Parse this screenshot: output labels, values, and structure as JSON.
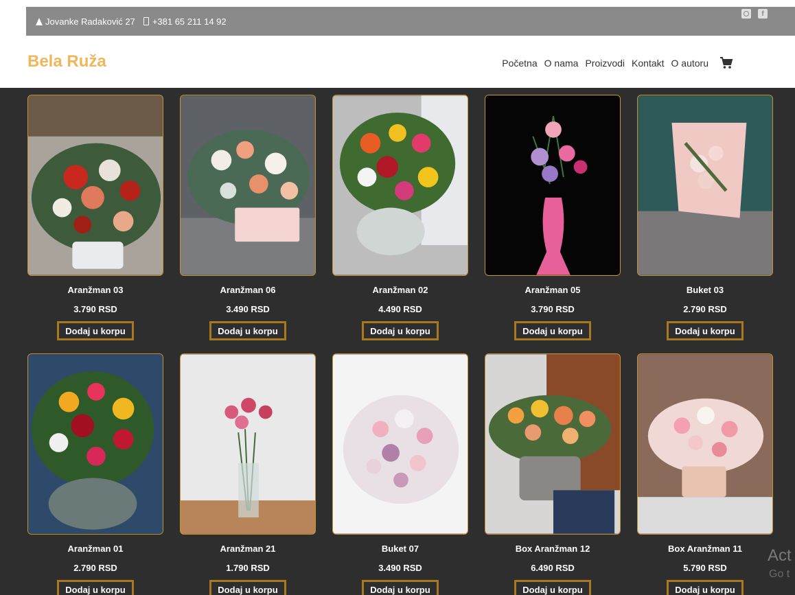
{
  "topbar": {
    "address": "Jovanke Radaković 27",
    "phone": "+381 65 211 14 92",
    "social": [
      "instagram-icon",
      "facebook-icon"
    ]
  },
  "header": {
    "logo": "Bela Ruža",
    "nav": [
      "Početna",
      "O nama",
      "Proizvodi",
      "Kontakt",
      "O autoru"
    ]
  },
  "products": [
    {
      "name": "Aranžman 03",
      "price": "3.790 RSD",
      "button": "Dodaj u korpu"
    },
    {
      "name": "Aranžman 06",
      "price": "3.490 RSD",
      "button": "Dodaj u korpu"
    },
    {
      "name": "Aranžman 02",
      "price": "4.490 RSD",
      "button": "Dodaj u korpu"
    },
    {
      "name": "Aranžman 05",
      "price": "3.790 RSD",
      "button": "Dodaj u korpu"
    },
    {
      "name": "Buket 03",
      "price": "2.790 RSD",
      "button": "Dodaj u korpu"
    },
    {
      "name": "Aranžman 01",
      "price": "2.790 RSD",
      "button": "Dodaj u korpu"
    },
    {
      "name": "Aranžman 21",
      "price": "1.790 RSD",
      "button": "Dodaj u korpu"
    },
    {
      "name": "Buket 07",
      "price": "3.490 RSD",
      "button": "Dodaj u korpu"
    },
    {
      "name": "Box Aranžman 12",
      "price": "6.490 RSD",
      "button": "Dodaj u korpu"
    },
    {
      "name": "Box Aranžman 11",
      "price": "5.790 RSD",
      "button": "Dodaj u korpu"
    }
  ],
  "overlay": {
    "line1": "Act",
    "line2": "Go t"
  },
  "colors": {
    "accent": "#f0b75a",
    "border": "#c8922c",
    "background": "#2e2e2e"
  }
}
